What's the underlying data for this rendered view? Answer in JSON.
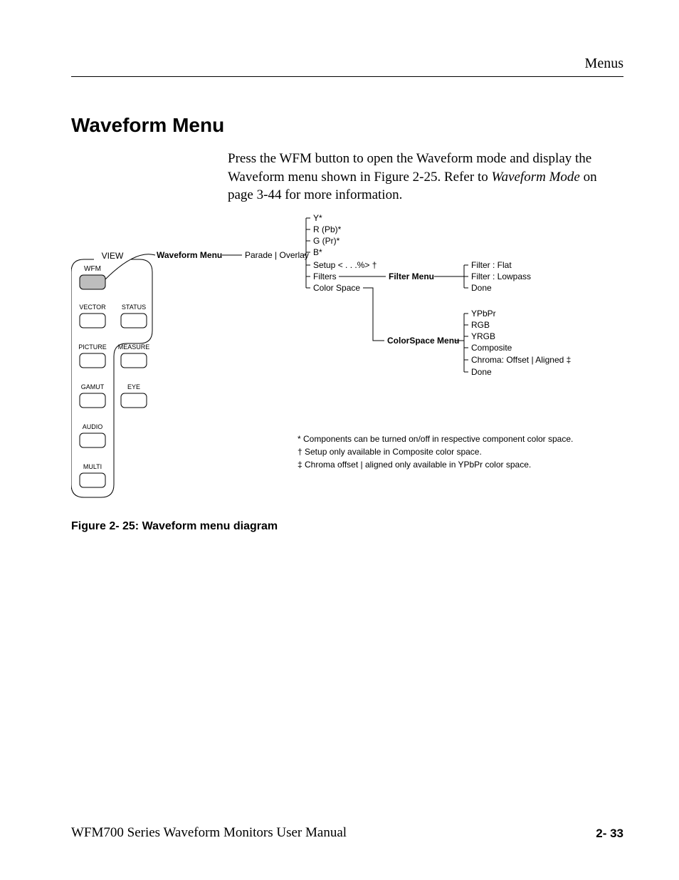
{
  "header": {
    "running": "Menus"
  },
  "title": "Waveform Menu",
  "intro": {
    "p1a": "Press the WFM button to open the Waveform mode and display the Waveform menu shown in Figure 2-25. Refer to ",
    "p1_em": "Waveform Mode",
    "p1b": " on page 3-44 for more information."
  },
  "diagram": {
    "view_label": "VIEW",
    "buttons": {
      "wfm": "WFM",
      "vector": "VECTOR",
      "status": "STATUS",
      "picture": "PICTURE",
      "measure": "MEASURE",
      "gamut": "GAMUT",
      "eye": "EYE",
      "audio": "AUDIO",
      "multi": "MULTI"
    },
    "root": "Waveform Menu",
    "root_child": "Parade | Overlay",
    "items": {
      "y": "Y*",
      "r": "R (Pb)*",
      "g": "G (Pr)*",
      "b": "B*",
      "setup": "Setup  < . . .%> †",
      "filters": "Filters",
      "colorspace": "Color Space"
    },
    "filter_menu": {
      "title": "Filter Menu",
      "flat": "Filter : Flat",
      "lowpass": "Filter : Lowpass",
      "done": "Done"
    },
    "cs_menu": {
      "title": "ColorSpace Menu",
      "ypbpr": "YPbPr",
      "rgb": "RGB",
      "yrgb": "YRGB",
      "composite": "Composite",
      "chroma": "Chroma: Offset | Aligned ‡",
      "done": "Done"
    },
    "notes": {
      "n1": "* Components can be turned on/off in respective component color space.",
      "n2": "† Setup only available in Composite color space.",
      "n3": "‡ Chroma offset | aligned only available in YPbPr color space."
    }
  },
  "caption": "Figure 2- 25: Waveform menu diagram",
  "footer": {
    "left": "WFM700 Series Waveform Monitors User Manual",
    "right": "2- 33"
  }
}
